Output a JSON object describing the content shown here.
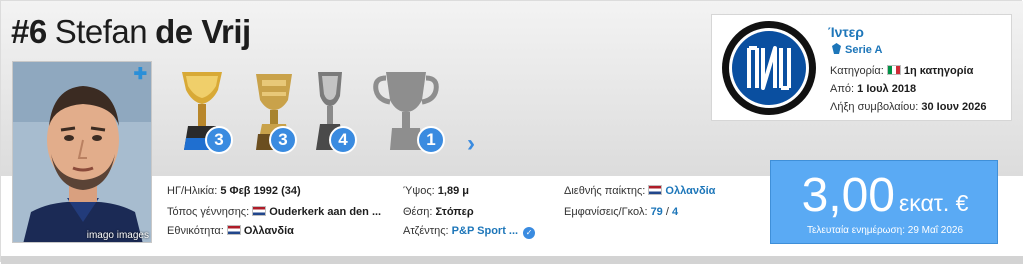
{
  "player": {
    "number": "#6",
    "first_name": "Stefan",
    "last_name": "de Vrij",
    "photo_credit": "imago images"
  },
  "trophies": [
    {
      "name": "league-trophy",
      "count": "3"
    },
    {
      "name": "cup-trophy",
      "count": "3"
    },
    {
      "name": "supercup-trophy",
      "count": "4"
    },
    {
      "name": "generic-trophy",
      "count": "1"
    }
  ],
  "club": {
    "name": "Ίντερ",
    "league": "Serie A",
    "category_label": "Κατηγορία:",
    "category_value": "1η κατηγορία",
    "since_label": "Από:",
    "since_value": "1 Ιουλ 2018",
    "contract_label": "Λήξη συμβολαίου:",
    "contract_value": "30 Ιουν 2026"
  },
  "info": {
    "dob_label": "ΗΓ/Ηλικία:",
    "dob_value": "5 Φεβ 1992 (34)",
    "birthplace_label": "Τόπος γέννησης:",
    "birthplace_value": "Ouderkerk aan den ...",
    "nationality_label": "Εθνικότητα:",
    "nationality_value": "Ολλανδία",
    "height_label": "Ύψος:",
    "height_value": "1,89 μ",
    "position_label": "Θέση:",
    "position_value": "Στόπερ",
    "agent_label": "Ατζέντης:",
    "agent_value": "P&P Sport ...",
    "intl_label": "Διεθνής παίκτης:",
    "intl_value": "Ολλανδία",
    "caps_label": "Εμφανίσεις/Γκολ:",
    "caps_value": "79",
    "caps_sep": " / ",
    "goals_value": "4"
  },
  "market_value": {
    "amount": "3,00",
    "unit": "εκατ. €",
    "updated": "Τελευταία ενημέρωση: 29 Μαΐ 2026"
  },
  "colors": {
    "accent": "#3a8be0",
    "link": "#1d76b9",
    "value_box": "#5aaaf4",
    "inter_blue": "#0a4fa0"
  }
}
